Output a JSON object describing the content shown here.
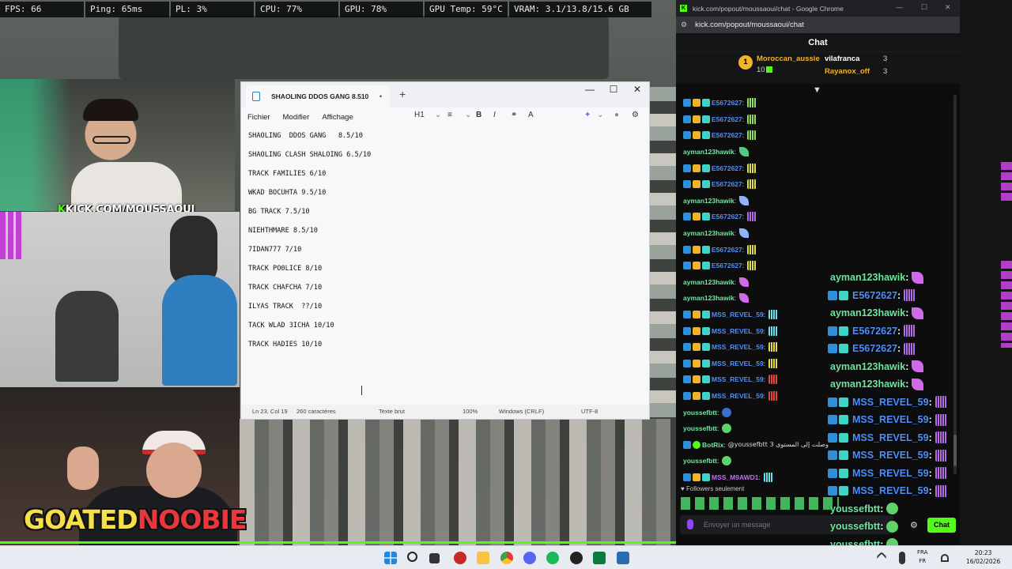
{
  "stats": [
    "FPS: 66",
    "Ping: 65ms",
    "PL: 3%",
    "CPU: 77%",
    "GPU: 78%",
    "GPU Temp: 59°C",
    "VRAM: 3.1/13.8/15.6 GB"
  ],
  "overlay": {
    "kick_url_k": "K",
    "kick_url": "KICK.COM/MOUSSAOUI",
    "goated": "GOATED",
    "noobie": "NOOBIE"
  },
  "notepad": {
    "tab_title": "SHAOLING  DDOS GANG   8.510",
    "tab_dot": "•",
    "menu": [
      "Fichier",
      "Modifier",
      "Affichage"
    ],
    "heading_tool": "H1",
    "lines": [
      "SHAOLING  DDOS GANG   8.5/10",
      "SHAOLING CLASH SHALOING 6.5/10",
      "TRACK FAMILIES 6/10",
      "WKAD BOCUHTA 9.5/10",
      "BG TRACK 7.5/10",
      "NIEHTHMARE 8.5/10",
      "7IDAN777 7/10",
      "TRACK PO0LICE 8/10",
      "TRACK CHAFCHA 7/10",
      "ILYAS TRACK  ??/10",
      "TACK WLAD 3ICHA 10/10",
      "TRACK HADIES 10/10"
    ],
    "status": {
      "position": "Ln 23, Col 19",
      "chars": "260 caractères",
      "format": "Texte brut",
      "zoom": "100%",
      "eol": "Windows (CRLF)",
      "encoding": "UTF-8"
    }
  },
  "chrome": {
    "title": "kick.com/popout/moussaoui/chat - Google Chrome",
    "url": "kick.com/popout/moussaoui/chat"
  },
  "chat": {
    "header": "Chat",
    "leaders": [
      {
        "rank": "1",
        "name": "Moroccan_aussie",
        "count": "10",
        "color": "#f0b429"
      },
      {
        "name": "vilafranca",
        "count": "3",
        "color": "#ffffff"
      },
      {
        "name": "Rayanox_off",
        "count": "3",
        "color": "#f0b429"
      }
    ],
    "messages": [
      {
        "badges": [
          "b-blue",
          "b-gold",
          "b-teal"
        ],
        "user": "E5672627",
        "color": "#4f8ff7",
        "emote": "e-green"
      },
      {
        "badges": [
          "b-blue",
          "b-gold",
          "b-teal"
        ],
        "user": "E5672627",
        "color": "#4f8ff7",
        "emote": "e-green"
      },
      {
        "badges": [
          "b-blue",
          "b-gold",
          "b-teal"
        ],
        "user": "E5672627",
        "color": "#4f8ff7",
        "emote": "e-green"
      },
      {
        "badges": [],
        "user": "ayman123hawik",
        "color": "#6ee7a0",
        "emote": "e-feather-g"
      },
      {
        "badges": [
          "b-blue",
          "b-gold",
          "b-teal"
        ],
        "user": "E5672627",
        "color": "#4f8ff7",
        "emote": "e-yellow"
      },
      {
        "badges": [
          "b-blue",
          "b-gold",
          "b-teal"
        ],
        "user": "E5672627",
        "color": "#4f8ff7",
        "emote": "e-yellow"
      },
      {
        "badges": [],
        "user": "ayman123hawik",
        "color": "#6ee7a0",
        "emote": "e-feather-b"
      },
      {
        "badges": [
          "b-blue",
          "b-gold",
          "b-teal"
        ],
        "user": "E5672627",
        "color": "#4f8ff7",
        "emote": "e-purple"
      },
      {
        "badges": [],
        "user": "ayman123hawik",
        "color": "#6ee7a0",
        "emote": "e-feather-b"
      },
      {
        "badges": [
          "b-blue",
          "b-gold",
          "b-teal"
        ],
        "user": "E5672627",
        "color": "#4f8ff7",
        "emote": "e-yellow"
      },
      {
        "badges": [
          "b-blue",
          "b-gold",
          "b-teal"
        ],
        "user": "E5672627",
        "color": "#4f8ff7",
        "emote": "e-yellow"
      },
      {
        "badges": [],
        "user": "ayman123hawik",
        "color": "#6ee7a0",
        "emote": "e-feather-p"
      },
      {
        "badges": [],
        "user": "ayman123hawik",
        "color": "#6ee7a0",
        "emote": "e-feather-p"
      },
      {
        "badges": [
          "b-blue",
          "b-gold",
          "b-teal"
        ],
        "user": "MSS_REVEL_59",
        "color": "#4f8ff7",
        "emote": "e-cyan"
      },
      {
        "badges": [
          "b-blue",
          "b-gold",
          "b-teal"
        ],
        "user": "MSS_REVEL_59",
        "color": "#4f8ff7",
        "emote": "e-cyan"
      },
      {
        "badges": [
          "b-blue",
          "b-gold",
          "b-teal"
        ],
        "user": "MSS_REVEL_59",
        "color": "#4f8ff7",
        "emote": "e-yellow"
      },
      {
        "badges": [
          "b-blue",
          "b-gold",
          "b-teal"
        ],
        "user": "MSS_REVEL_59",
        "color": "#4f8ff7",
        "emote": "e-yellow"
      },
      {
        "badges": [
          "b-blue",
          "b-gold",
          "b-teal"
        ],
        "user": "MSS_REVEL_59",
        "color": "#4f8ff7",
        "emote": "e-red"
      },
      {
        "badges": [
          "b-blue",
          "b-gold",
          "b-teal"
        ],
        "user": "MSS_REVEL_59",
        "color": "#4f8ff7",
        "emote": "e-red"
      },
      {
        "badges": [],
        "user": "youssefbtt",
        "color": "#6ee7a0",
        "emote": "e-blue-face"
      },
      {
        "badges": [],
        "user": "youssefbtt",
        "color": "#6ee7a0",
        "emote": "e-face"
      },
      {
        "badges": [
          "b-blue",
          "b-green"
        ],
        "user": "BotRix",
        "color": "#6ee7a0",
        "text": "@youssefbtt وصلت إلى المستوى 3"
      },
      {
        "badges": [],
        "user": "youssefbtt",
        "color": "#6ee7a0",
        "emote": "e-face"
      },
      {
        "badges": [
          "b-blue",
          "b-gold",
          "b-teal"
        ],
        "user": "MSS_M9AWD1",
        "color": "#c06bf7",
        "emote": "e-cyan"
      }
    ],
    "followers_only": "Followers seulement",
    "input_placeholder": "Envoyer un message",
    "send_label": "Chat"
  },
  "stream_overlay_chat": [
    {
      "user": "ayman123hawik",
      "color": "#6ee7a0",
      "badges": [],
      "emote": "e-feather-p"
    },
    {
      "user": "E5672627",
      "color": "#4f8ff7",
      "badges": [
        "b-blue",
        "b-teal"
      ],
      "emote": "e-purple"
    },
    {
      "user": "ayman123hawik",
      "color": "#6ee7a0",
      "badges": [],
      "emote": "e-feather-p"
    },
    {
      "user": "E5672627",
      "color": "#4f8ff7",
      "badges": [
        "b-blue",
        "b-teal"
      ],
      "emote": "e-purple"
    },
    {
      "user": "E5672627",
      "color": "#4f8ff7",
      "badges": [
        "b-blue",
        "b-teal"
      ],
      "emote": "e-purple"
    },
    {
      "user": "ayman123hawik",
      "color": "#6ee7a0",
      "badges": [],
      "emote": "e-feather-p"
    },
    {
      "user": "ayman123hawik",
      "color": "#6ee7a0",
      "badges": [],
      "emote": "e-feather-p"
    },
    {
      "user": "MSS_REVEL_59",
      "color": "#4f8ff7",
      "badges": [
        "b-blue",
        "b-teal"
      ],
      "emote": "e-purple"
    },
    {
      "user": "MSS_REVEL_59",
      "color": "#4f8ff7",
      "badges": [
        "b-blue",
        "b-teal"
      ],
      "emote": "e-purple"
    },
    {
      "user": "MSS_REVEL_59",
      "color": "#4f8ff7",
      "badges": [
        "b-blue",
        "b-teal"
      ],
      "emote": "e-purple"
    },
    {
      "user": "MSS_REVEL_59",
      "color": "#4f8ff7",
      "badges": [
        "b-blue",
        "b-teal"
      ],
      "emote": "e-purple"
    },
    {
      "user": "MSS_REVEL_59",
      "color": "#4f8ff7",
      "badges": [
        "b-blue",
        "b-teal"
      ],
      "emote": "e-purple"
    },
    {
      "user": "MSS_REVEL_59",
      "color": "#4f8ff7",
      "badges": [
        "b-blue",
        "b-teal"
      ],
      "emote": "e-purple"
    },
    {
      "user": "youssefbtt",
      "color": "#6ee7a0",
      "badges": [],
      "emote": "e-face"
    },
    {
      "user": "youssefbtt",
      "color": "#6ee7a0",
      "badges": [],
      "emote": "e-face"
    },
    {
      "user": "youssefbtt",
      "color": "#6ee7a0",
      "badges": [],
      "emote": "e-face"
    }
  ],
  "taskbar": {
    "lang_top": "FRA",
    "lang_bottom": "FR",
    "time": "20:23",
    "date": "16/02/2026"
  }
}
